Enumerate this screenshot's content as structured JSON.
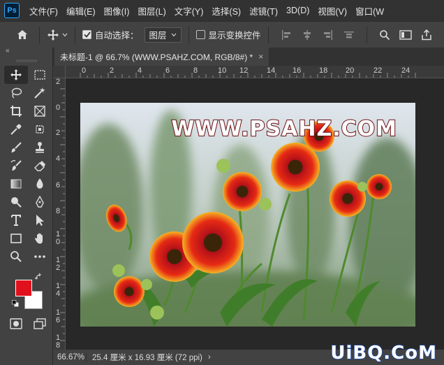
{
  "app": {
    "logo_text": "Ps"
  },
  "menu": {
    "items": [
      "文件(F)",
      "编辑(E)",
      "图像(I)",
      "图层(L)",
      "文字(Y)",
      "选择(S)",
      "滤镜(T)",
      "3D(D)",
      "视图(V)",
      "窗口(W"
    ]
  },
  "options": {
    "auto_select_label": "自动选择：",
    "auto_select_checked": true,
    "auto_select_target": "图层",
    "show_transform_label": "显示变换控件",
    "show_transform_checked": false
  },
  "document": {
    "tab_title": "未标题-1 @ 66.7% (WWW.PSAHZ.COM, RGB/8#) *",
    "close_glyph": "×",
    "watermark_text": "WWW.PSAHZ.COM"
  },
  "rulers": {
    "horizontal": [
      "0",
      "2",
      "4",
      "6",
      "8",
      "10",
      "12",
      "14",
      "16",
      "18",
      "20",
      "22",
      "24"
    ],
    "vertical": [
      "2",
      "0",
      "2",
      "4",
      "6",
      "8",
      "1\n0",
      "1\n2",
      "1\n4",
      "1\n6",
      "1\n8"
    ]
  },
  "status": {
    "zoom": "66.67%",
    "doc_info": "25.4 厘米 x 16.93 厘米 (72 ppi)",
    "arrow": "›"
  },
  "colors": {
    "foreground": "#e0101c",
    "background": "#ffffff"
  },
  "site_watermark": "UiBQ.CoM",
  "toolbar": {
    "collapse_glyph": "«"
  }
}
